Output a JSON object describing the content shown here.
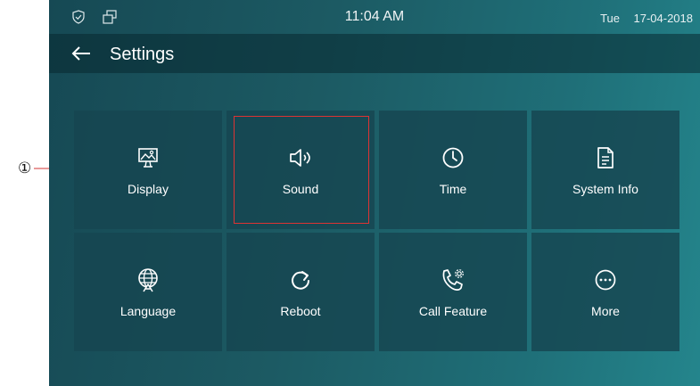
{
  "annotation": {
    "label": "①",
    "line_color": "#d33333"
  },
  "statusbar": {
    "time": "11:04 AM",
    "day": "Tue",
    "date": "17-04-2018",
    "left_icons": [
      "shield-check-icon",
      "windows-icon"
    ]
  },
  "header": {
    "title": "Settings",
    "back_icon": "left-arrow-icon"
  },
  "tiles": [
    {
      "label": "Display",
      "icon": "display-icon"
    },
    {
      "label": "Sound",
      "icon": "speaker-icon"
    },
    {
      "label": "Time",
      "icon": "clock-icon"
    },
    {
      "label": "System Info",
      "icon": "document-icon"
    },
    {
      "label": "Language",
      "icon": "globe-language-icon"
    },
    {
      "label": "Reboot",
      "icon": "reboot-icon"
    },
    {
      "label": "Call Feature",
      "icon": "phone-gear-icon"
    },
    {
      "label": "More",
      "icon": "more-icon"
    }
  ],
  "colors": {
    "background_start": "#164954",
    "background_end": "#24858c",
    "tile": "#1a4a54",
    "text": "#ffffff",
    "highlight": "#d33333"
  }
}
